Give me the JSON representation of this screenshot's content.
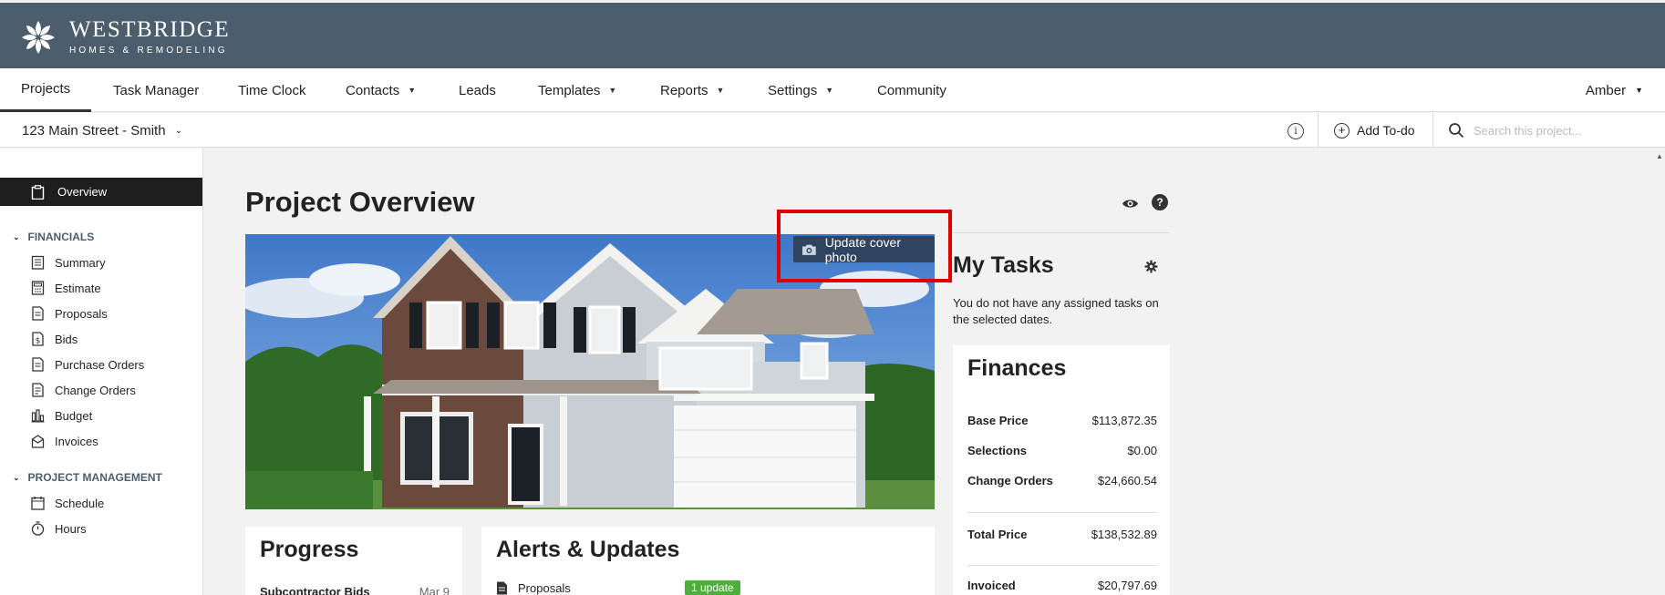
{
  "brand": {
    "name": "WESTBRIDGE",
    "tagline": "HOMES & REMODELING"
  },
  "nav": {
    "items": [
      {
        "label": "Projects",
        "active": true,
        "dropdown": false
      },
      {
        "label": "Task Manager",
        "dropdown": false
      },
      {
        "label": "Time Clock",
        "dropdown": false
      },
      {
        "label": "Contacts",
        "dropdown": true
      },
      {
        "label": "Leads",
        "dropdown": false
      },
      {
        "label": "Templates",
        "dropdown": true
      },
      {
        "label": "Reports",
        "dropdown": true
      },
      {
        "label": "Settings",
        "dropdown": true
      },
      {
        "label": "Community",
        "dropdown": false
      }
    ],
    "user": "Amber"
  },
  "subbar": {
    "project": "123 Main Street - Smith",
    "add_todo": "Add To-do",
    "search_placeholder": "Search this project..."
  },
  "sidebar": {
    "overview": "Overview",
    "sections": [
      {
        "title": "FINANCIALS",
        "items": [
          {
            "label": "Summary",
            "icon": "summary-icon"
          },
          {
            "label": "Estimate",
            "icon": "calculator-icon"
          },
          {
            "label": "Proposals",
            "icon": "document-icon"
          },
          {
            "label": "Bids",
            "icon": "dollar-document-icon"
          },
          {
            "label": "Purchase Orders",
            "icon": "document-icon"
          },
          {
            "label": "Change Orders",
            "icon": "change-order-icon"
          },
          {
            "label": "Budget",
            "icon": "bar-chart-icon"
          },
          {
            "label": "Invoices",
            "icon": "invoice-icon"
          }
        ]
      },
      {
        "title": "PROJECT MANAGEMENT",
        "items": [
          {
            "label": "Schedule",
            "icon": "calendar-icon"
          },
          {
            "label": "Hours",
            "icon": "stopwatch-icon"
          }
        ]
      }
    ]
  },
  "main": {
    "title": "Project Overview",
    "cover_button": "Update cover photo",
    "tasks": {
      "title": "My Tasks",
      "empty_text": "You do not have any assigned tasks on the selected dates."
    },
    "finances": {
      "title": "Finances",
      "rows": [
        {
          "label": "Base Price",
          "value": "$113,872.35"
        },
        {
          "label": "Selections",
          "value": "$0.00"
        },
        {
          "label": "Change Orders",
          "value": "$24,660.54"
        },
        {
          "label": "Total Price",
          "value": "$138,532.89"
        },
        {
          "label": "Invoiced",
          "value": "$20,797.69"
        }
      ]
    },
    "progress": {
      "title": "Progress",
      "rows": [
        {
          "label": "Subcontractor Bids",
          "value": "Mar 9"
        }
      ]
    },
    "alerts": {
      "title": "Alerts & Updates",
      "rows": [
        {
          "label": "Proposals",
          "badge": "1 update"
        }
      ]
    }
  },
  "colors": {
    "header": "#4c5d6d",
    "cover_button": "#2e4461",
    "highlight": "#e00000",
    "badge": "#4caf3a"
  }
}
